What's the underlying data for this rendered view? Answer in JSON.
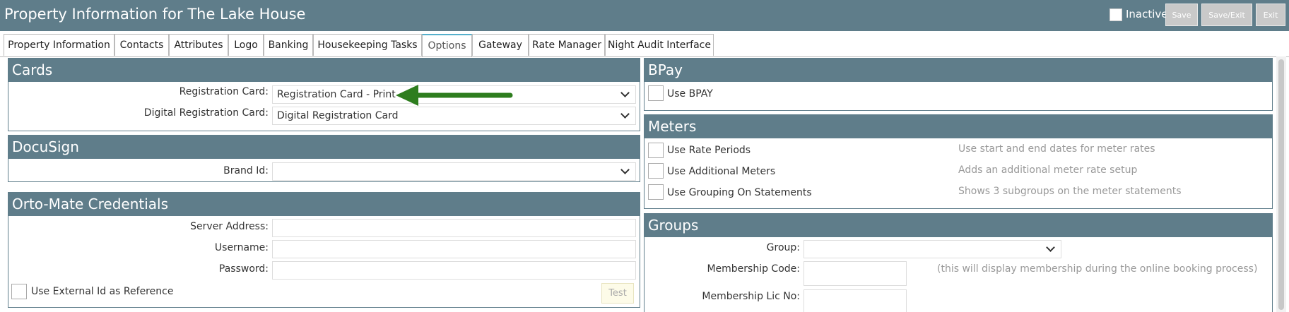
{
  "header": {
    "title": "Property Information for The Lake House",
    "inactive_label": "Inactive",
    "buttons": {
      "save": "Save",
      "save_exit": "Save/Exit",
      "exit": "Exit"
    }
  },
  "tabs": [
    {
      "label": "Property Information"
    },
    {
      "label": "Contacts"
    },
    {
      "label": "Attributes"
    },
    {
      "label": "Logo"
    },
    {
      "label": "Banking"
    },
    {
      "label": "Housekeeping Tasks"
    },
    {
      "label": "Options",
      "active": true
    },
    {
      "label": "Gateway"
    },
    {
      "label": "Rate Manager"
    },
    {
      "label": "Night Audit Interface"
    }
  ],
  "cards": {
    "title": "Cards",
    "registration_card_label": "Registration Card:",
    "registration_card_value": "Registration Card - Print",
    "digital_registration_card_label": "Digital Registration Card:",
    "digital_registration_card_value": "Digital Registration Card"
  },
  "docusign": {
    "title": "DocuSign",
    "brand_id_label": "Brand Id:",
    "brand_id_value": ""
  },
  "ortomate": {
    "title": "Orto-Mate Credentials",
    "server_address_label": "Server Address:",
    "username_label": "Username:",
    "password_label": "Password:",
    "use_external_id_label": "Use External Id as Reference",
    "test_label": "Test"
  },
  "bpay": {
    "title": "BPay",
    "use_bpay_label": "Use BPAY"
  },
  "meters": {
    "title": "Meters",
    "items": [
      {
        "label": "Use Rate Periods",
        "hint": "Use start and end dates for meter rates"
      },
      {
        "label": "Use Additional Meters",
        "hint": "Adds an additional meter rate setup"
      },
      {
        "label": "Use Grouping On Statements",
        "hint": "Shows 3 subgroups on the meter statements"
      }
    ]
  },
  "groups": {
    "title": "Groups",
    "group_label": "Group:",
    "group_value": "",
    "membership_code_label": "Membership Code:",
    "membership_code_hint": "(this will display membership during the online booking process)",
    "membership_lic_label": "Membership Lic No:"
  },
  "colors": {
    "header_bg": "#5f7d8a",
    "arrow": "#2e7d1e",
    "active_tab_accent": "#56b0cc"
  }
}
